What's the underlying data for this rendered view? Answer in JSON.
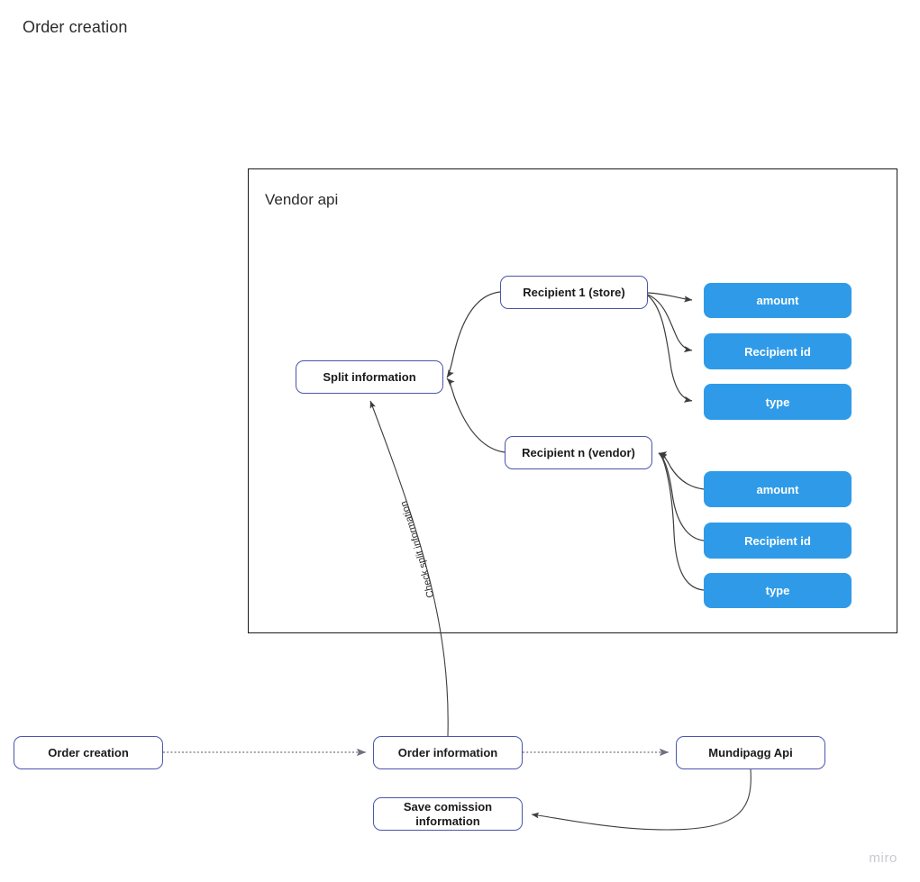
{
  "board": {
    "title": "Order creation",
    "watermark": "miro"
  },
  "frame": {
    "title": "Vendor api"
  },
  "colors": {
    "chip_fill": "#2f9be8",
    "node_border": "#4a55ab",
    "frame_border": "#1a1a1a",
    "connector": "#3d3d3d",
    "connector_dotted": "#8a8a96",
    "text": "#1a1a1a",
    "watermark": "#c9c9d1"
  },
  "nodes": {
    "split_information": "Split information",
    "recipient_1": "Recipient 1 (store)",
    "recipient_n": "Recipient n (vendor)",
    "order_creation": "Order creation",
    "order_information": "Order information",
    "mundipagg_api": "Mundipagg Api",
    "save_commission_line1": "Save comission",
    "save_commission_line2": "information"
  },
  "chips": {
    "recipient_1": [
      {
        "label": "amount"
      },
      {
        "label": "Recipient id"
      },
      {
        "label": "type"
      }
    ],
    "recipient_n": [
      {
        "label": "amount"
      },
      {
        "label": "Recipient id"
      },
      {
        "label": "type"
      }
    ]
  },
  "edges": {
    "check_split_information": "Check split information"
  }
}
